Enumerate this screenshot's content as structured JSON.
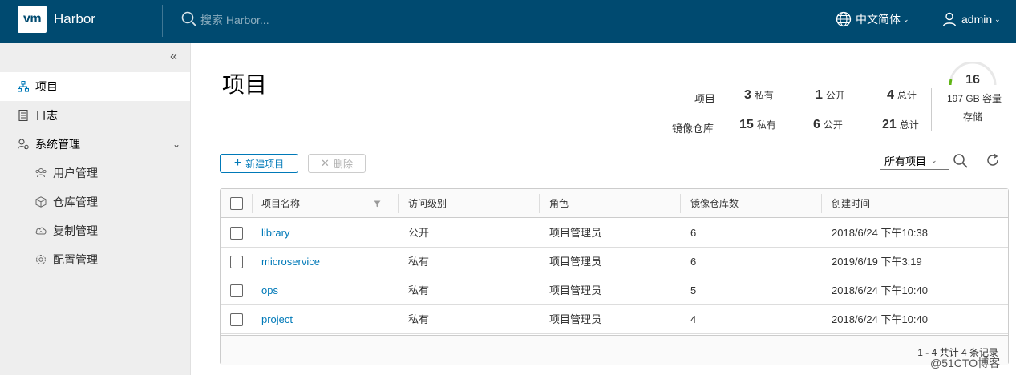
{
  "header": {
    "logo_text": "vm",
    "app_title": "Harbor",
    "search_placeholder": "搜索 Harbor...",
    "language": "中文简体",
    "user": "admin"
  },
  "sidebar": {
    "items": [
      {
        "label": "项目",
        "icon": "projects-icon",
        "active": true
      },
      {
        "label": "日志",
        "icon": "log-icon"
      },
      {
        "label": "系统管理",
        "icon": "admin-icon"
      }
    ],
    "sub_items": [
      {
        "label": "用户管理",
        "icon": "users-icon"
      },
      {
        "label": "仓库管理",
        "icon": "registry-icon"
      },
      {
        "label": "复制管理",
        "icon": "replication-icon"
      },
      {
        "label": "配置管理",
        "icon": "config-icon"
      }
    ]
  },
  "main": {
    "title": "项目",
    "stats": {
      "project_label": "项目",
      "repo_label": "镜像仓库",
      "project_private": "3",
      "project_public": "1",
      "project_total": "4",
      "repo_private": "15",
      "repo_public": "6",
      "repo_total": "21",
      "private_unit": "私有",
      "public_unit": "公开",
      "total_unit": "总计"
    },
    "storage": {
      "value": "16",
      "capacity": "197 GB 容量",
      "label": "存储"
    },
    "toolbar": {
      "new_label": "新建项目",
      "delete_label": "删除",
      "filter_value": "所有项目"
    },
    "table": {
      "columns": [
        "项目名称",
        "访问级别",
        "角色",
        "镜像仓库数",
        "创建时间"
      ],
      "rows": [
        {
          "name": "library",
          "access": "公开",
          "role": "项目管理员",
          "repos": "6",
          "created": "2018/6/24 下午10:38"
        },
        {
          "name": "microservice",
          "access": "私有",
          "role": "项目管理员",
          "repos": "6",
          "created": "2019/6/19 下午3:19"
        },
        {
          "name": "ops",
          "access": "私有",
          "role": "项目管理员",
          "repos": "5",
          "created": "2018/6/24 下午10:40"
        },
        {
          "name": "project",
          "access": "私有",
          "role": "项目管理员",
          "repos": "4",
          "created": "2018/6/24 下午10:40"
        }
      ],
      "footer": "1 - 4 共计 4 条记录"
    }
  },
  "watermark": "@51CTO博客",
  "colors": {
    "header_bg": "#004a70",
    "link": "#0079b8",
    "sidebar_bg": "#eeeeee"
  }
}
